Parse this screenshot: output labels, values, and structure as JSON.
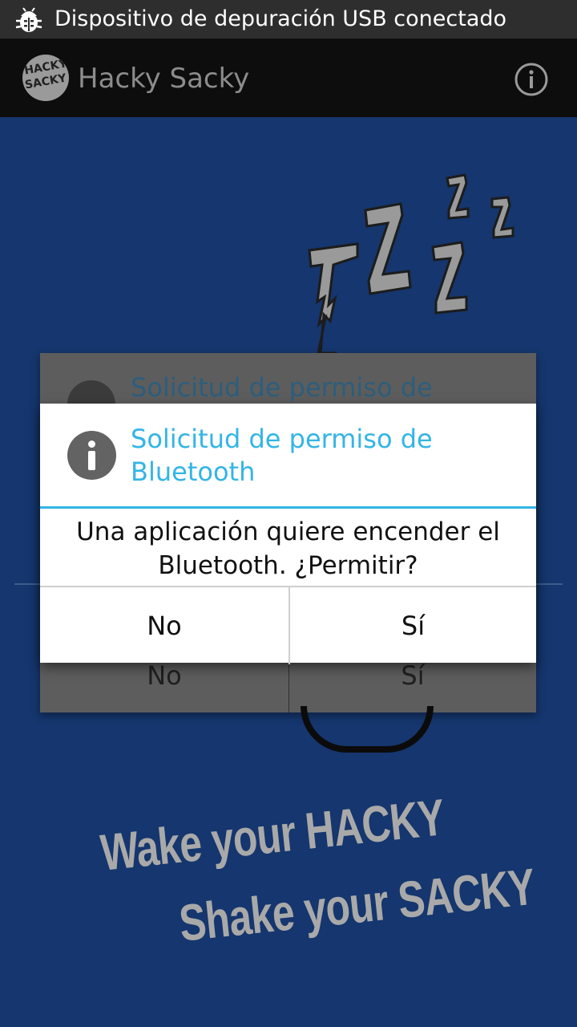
{
  "status_bar": {
    "notification_icon": "android-debug-bug-icon",
    "text": "Dispositivo de depuración USB conectado"
  },
  "action_bar": {
    "logo_text_line1": "HACKY",
    "logo_text_line2": "SACKY",
    "title": "Hacky Sacky",
    "info_icon": "info-circle-icon"
  },
  "background": {
    "art": "sleeping-zzz-graphic",
    "slogan_line1": "Wake your HACKY",
    "slogan_line2": "Shake your SACKY"
  },
  "background_dialog": {
    "title": "Solicitud de permiso de",
    "no_label": "No",
    "yes_label": "Sí"
  },
  "dialog": {
    "icon": "info-icon",
    "title": "Solicitud de permiso de Bluetooth",
    "message": "Una aplicación quiere encender el Bluetooth. ¿Permitir?",
    "buttons": {
      "no": "No",
      "yes": "Sí"
    }
  },
  "colors": {
    "accent": "#33b5e5",
    "screen_background": "#15366e",
    "action_bar": "#0d0d0d",
    "status_bar": "#2e2e2e"
  }
}
